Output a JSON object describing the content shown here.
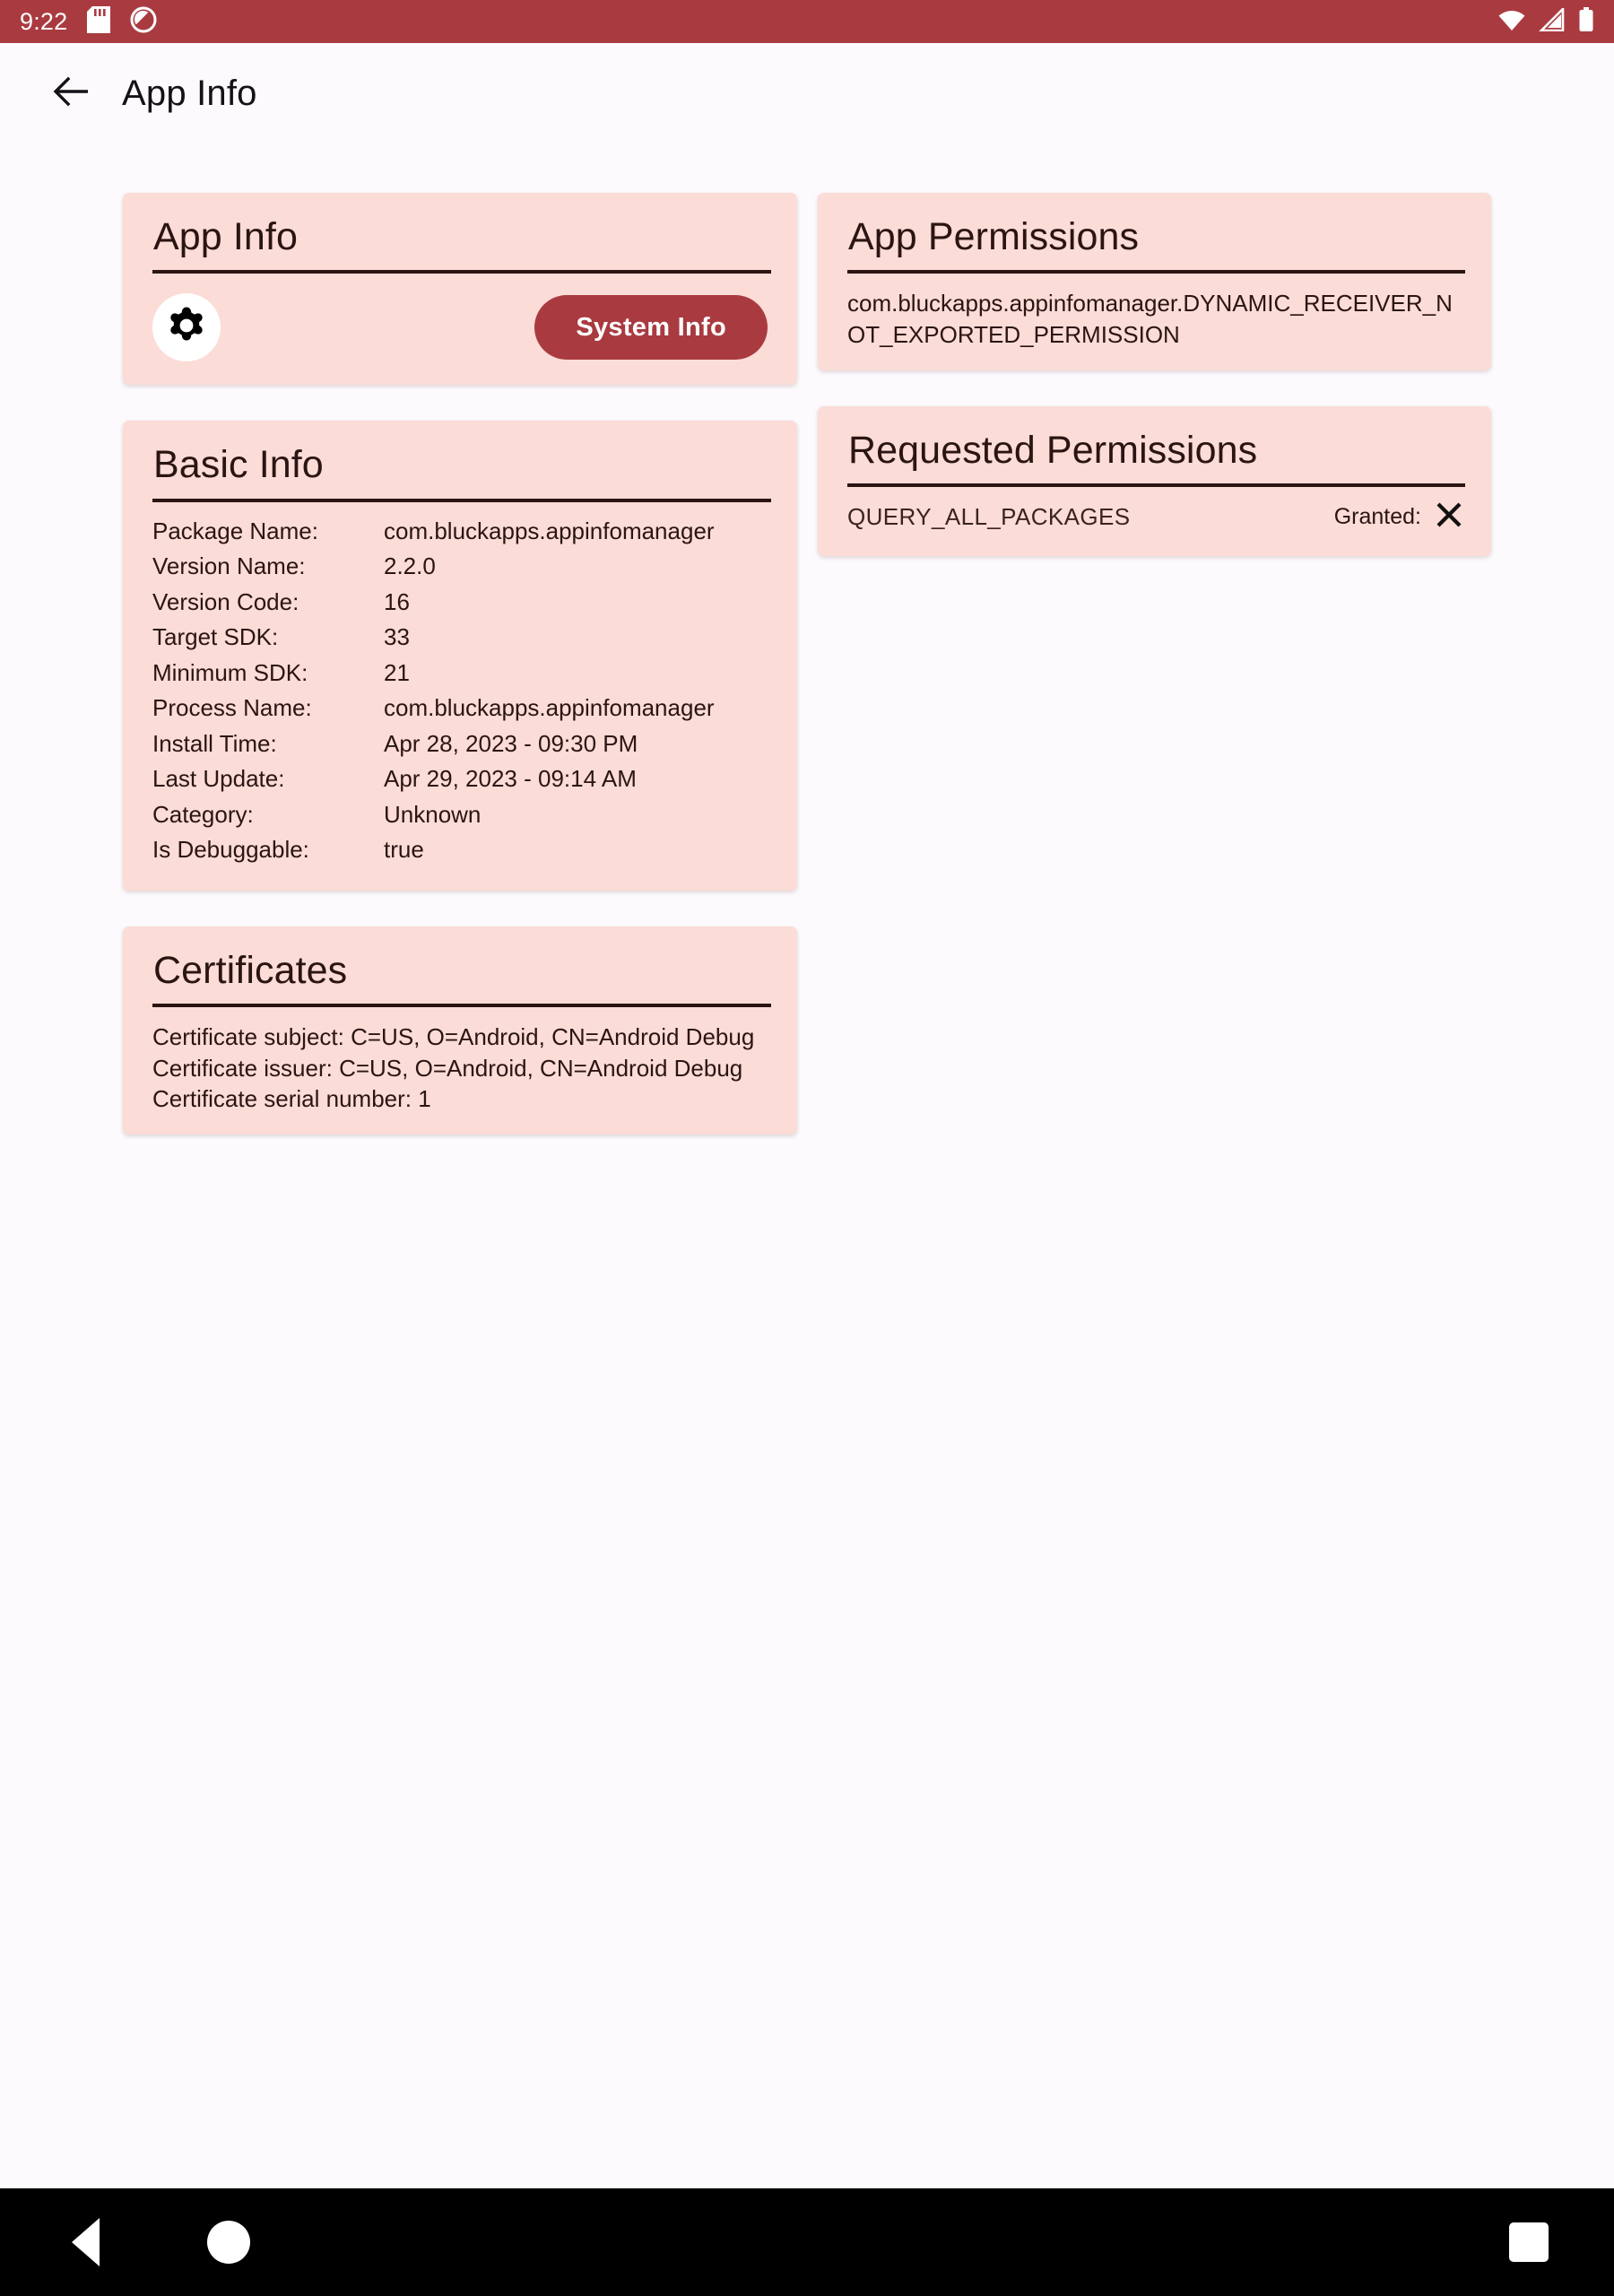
{
  "status_bar": {
    "time": "9:22",
    "icons_left": [
      "sd-card-icon",
      "do-not-disturb-icon"
    ],
    "icons_right": [
      "wifi-icon",
      "cell-signal-icon",
      "battery-icon"
    ],
    "background_color": "#A93B40"
  },
  "app_bar": {
    "back_icon": "arrow-back-icon",
    "title": "App Info"
  },
  "theme": {
    "card_background": "#FBDCD7",
    "accent": "#A93B40",
    "text": "#2B1512",
    "page_background": "#FCFAFD"
  },
  "cards": {
    "app_info": {
      "title": "App Info",
      "gear_icon": "gear-icon",
      "system_info_button": "System Info"
    },
    "basic_info": {
      "title": "Basic Info",
      "rows": [
        {
          "key": "Package Name:",
          "value": "com.bluckapps.appinfomanager"
        },
        {
          "key": "Version Name:",
          "value": "2.2.0"
        },
        {
          "key": "Version Code:",
          "value": "16"
        },
        {
          "key": "Target SDK:",
          "value": "33"
        },
        {
          "key": "Minimum SDK:",
          "value": "21"
        },
        {
          "key": "Process Name:",
          "value": "com.bluckapps.appinfomanager"
        },
        {
          "key": "Install Time:",
          "value": "Apr 28, 2023 - 09:30 PM"
        },
        {
          "key": "Last Update:",
          "value": "Apr 29, 2023 - 09:14 AM"
        },
        {
          "key": "Category:",
          "value": "Unknown"
        },
        {
          "key": "Is Debuggable:",
          "value": "true"
        }
      ]
    },
    "certificates": {
      "title": "Certificates",
      "lines": [
        "Certificate subject: C=US, O=Android, CN=Android Debug",
        "Certificate issuer: C=US, O=Android, CN=Android Debug",
        "Certificate serial number: 1"
      ]
    },
    "app_permissions": {
      "title": "App Permissions",
      "entries": [
        "com.bluckapps.appinfomanager.DYNAMIC_RECEIVER_NOT_EXPORTED_PERMISSION"
      ]
    },
    "requested_permissions": {
      "title": "Requested Permissions",
      "rows": [
        {
          "name": "QUERY_ALL_PACKAGES",
          "granted_label": "Granted:",
          "granted": false,
          "granted_icon": "close-x-icon"
        }
      ]
    }
  },
  "nav_bar": {
    "back": "back-triangle-icon",
    "home": "home-circle-icon",
    "recents": "recents-square-icon"
  }
}
